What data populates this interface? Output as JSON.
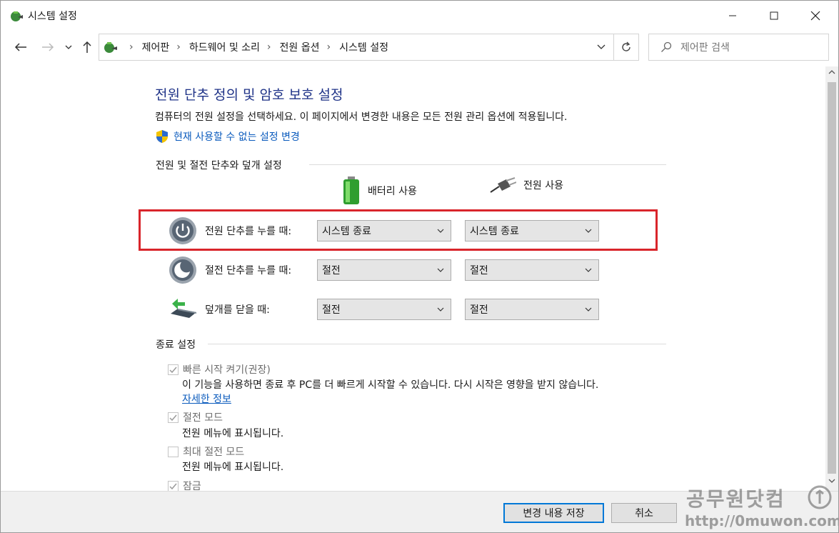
{
  "window": {
    "title": "시스템 설정"
  },
  "nav": {
    "breadcrumbs": [
      "제어판",
      "하드웨어 및 소리",
      "전원 옵션",
      "시스템 설정"
    ],
    "search_placeholder": "제어판 검색"
  },
  "page": {
    "title": "전원 단추 정의 및 암호 보호 설정",
    "description": "컴퓨터의 전원 설정을 선택하세요. 이 페이지에서 변경한 내용은 모든 전원 관리 옵션에 적용됩니다.",
    "admin_link": "현재 사용할 수 없는 설정 변경"
  },
  "power_group": {
    "label": "전원 및 절전 단추와 덮개 설정",
    "columns": {
      "battery": "배터리 사용",
      "plugged": "전원 사용"
    },
    "rows": [
      {
        "label": "전원 단추를 누를 때:",
        "battery": "시스템 종료",
        "plugged": "시스템 종료"
      },
      {
        "label": "절전 단추를 누를 때:",
        "battery": "절전",
        "plugged": "절전"
      },
      {
        "label": "덮개를 닫을 때:",
        "battery": "절전",
        "plugged": "절전"
      }
    ]
  },
  "shutdown_group": {
    "label": "종료 설정",
    "items": [
      {
        "label": "빠른 시작 켜기(권장)",
        "checked": true,
        "desc": "이 기능을 사용하면 종료 후 PC를 더 빠르게 시작할 수 있습니다. 다시 시작은 영향을 받지 않습니다.",
        "link": "자세한 정보"
      },
      {
        "label": "절전 모드",
        "checked": true,
        "desc": "전원 메뉴에 표시됩니다."
      },
      {
        "label": "최대 절전 모드",
        "checked": false,
        "desc": "전원 메뉴에 표시됩니다."
      },
      {
        "label": "잠금",
        "checked": true
      }
    ]
  },
  "buttons": {
    "save": "변경 내용 저장",
    "cancel": "취소"
  },
  "watermark": {
    "line1": "공무원닷컴",
    "line2": "http://0muwon.com"
  },
  "colors": {
    "highlight": "#d9252b",
    "link": "#0b5bbd",
    "title": "#1e3287"
  }
}
